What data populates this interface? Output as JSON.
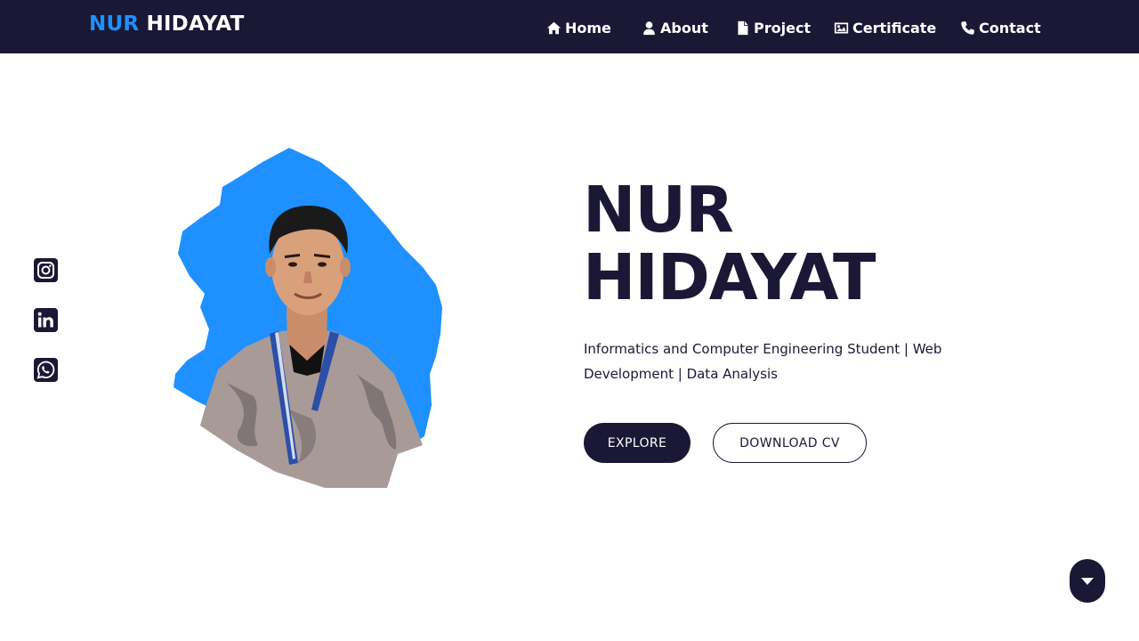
{
  "brand": {
    "first": "NUR",
    "last": "HIDAYAT"
  },
  "nav": {
    "items": [
      {
        "label": "Home",
        "icon": "home-icon"
      },
      {
        "label": "About",
        "icon": "user-icon"
      },
      {
        "label": "Project",
        "icon": "file-icon"
      },
      {
        "label": "Certificate",
        "icon": "image-icon"
      },
      {
        "label": "Contact",
        "icon": "phone-icon"
      }
    ]
  },
  "socials": [
    {
      "icon": "instagram-icon"
    },
    {
      "icon": "linkedin-icon"
    },
    {
      "icon": "whatsapp-icon"
    }
  ],
  "hero": {
    "name_line1": "NUR",
    "name_line2": "HIDAYAT",
    "description": "Informatics and Computer Engineering Student | Web Development | Data Analysis",
    "explore_label": "EXPLORE",
    "download_label": "DOWNLOAD CV"
  },
  "scroll_icon": "caret-down-icon",
  "colors": {
    "navbar_bg": "#1b1836",
    "accent": "#1e90ff",
    "text_dark": "#1b1836",
    "background": "#ffffff"
  }
}
